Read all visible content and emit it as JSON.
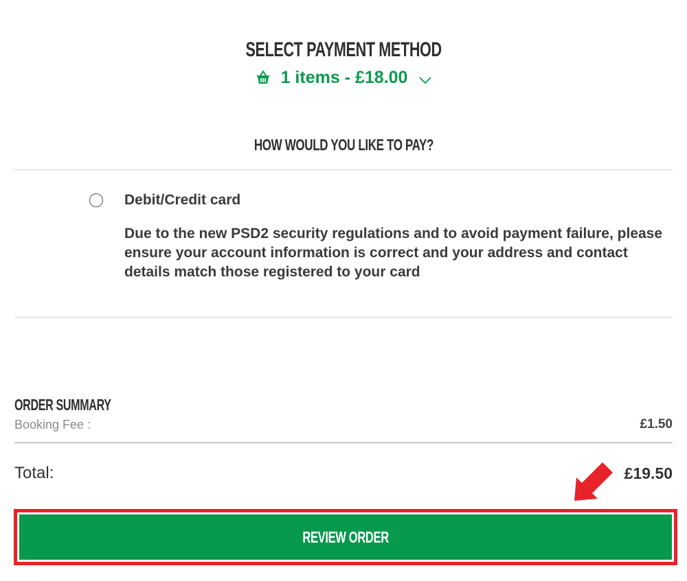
{
  "header": {
    "title": "SELECT PAYMENT METHOD"
  },
  "basket": {
    "icon": "basket-icon",
    "summary": "1 items - £18.00",
    "toggle_icon": "chevron-down-icon",
    "color": "#0a9a4f"
  },
  "payment": {
    "heading": "HOW WOULD YOU LIKE TO PAY?",
    "options": [
      {
        "label": "Debit/Credit card",
        "selected": false,
        "description": "Due to the new PSD2 security regulations and to avoid payment failure, please ensure your account information is correct and your address and contact details match those registered to your card"
      }
    ]
  },
  "order_summary": {
    "heading": "ORDER SUMMARY",
    "booking_fee_label": "Booking Fee :",
    "booking_fee_value": "£1.50",
    "total_label": "Total:",
    "total_value": "£19.50"
  },
  "actions": {
    "review_label": "REVIEW ORDER",
    "button_color": "#07994d"
  },
  "annotation": {
    "highlight_color": "#e8222b",
    "arrow_icon": "arrow-down-left-icon"
  }
}
